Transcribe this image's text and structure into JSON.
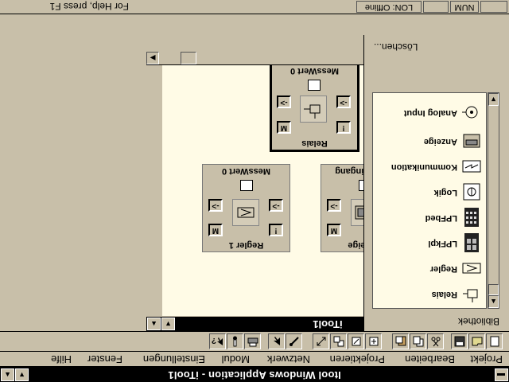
{
  "window": {
    "title": "Itool Windows Application - iTool1"
  },
  "menu": [
    "Projekt",
    "Bearbeiten",
    "Projektieren",
    "Netzwerk",
    "Modul",
    "Einstellungen",
    "Fenster",
    "Hilfe"
  ],
  "child_window": {
    "title": "iTool1"
  },
  "modules": [
    {
      "id": "relais",
      "title": "MessWert 0",
      "name": "Relais",
      "selected": true
    },
    {
      "id": "regler",
      "title": "MessWert 0",
      "name": "Regler 1",
      "selected": false
    },
    {
      "id": "anzeige",
      "title": "AlarmEingang",
      "name": "Anzeige",
      "selected": false
    }
  ],
  "module_buttons": {
    "in": "->",
    "out": "->",
    "mode": "M",
    "alarm": "!"
  },
  "side_panel": {
    "header": "Bibliothek",
    "footer": "Löschen...",
    "items": [
      {
        "label": "Relais",
        "icon": "relay-icon"
      },
      {
        "label": "Regler",
        "icon": "controller-icon"
      },
      {
        "label": "LPFkpl",
        "icon": "lpf-kpl-icon"
      },
      {
        "label": "LPFbed",
        "icon": "lpf-bed-icon"
      },
      {
        "label": "Logik",
        "icon": "logic-icon"
      },
      {
        "label": "Kommunikation",
        "icon": "communication-icon"
      },
      {
        "label": "Anzeige",
        "icon": "display-icon"
      },
      {
        "label": "Analog Input",
        "icon": "analog-input-icon"
      }
    ]
  },
  "status": {
    "help": "For Help, press F1",
    "mode": "LON: Offline",
    "num": "NUM"
  }
}
